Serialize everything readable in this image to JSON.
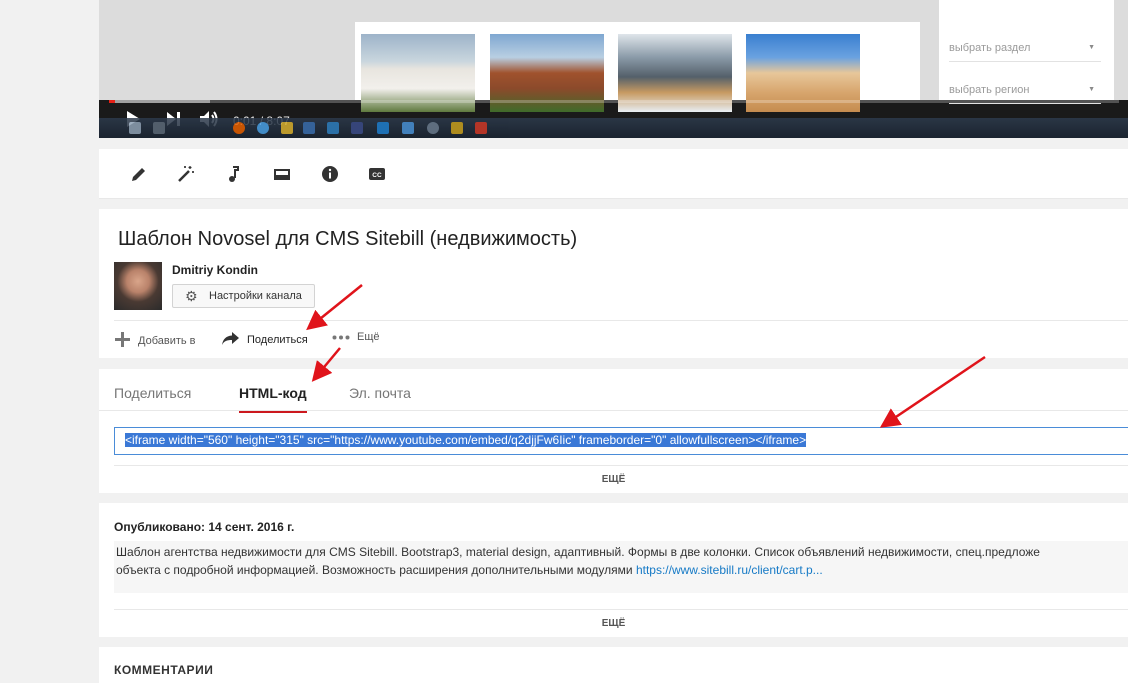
{
  "player": {
    "current_time": "0:01",
    "separator": "/",
    "duration": "8:07",
    "progress": 0.002,
    "filters": [
      {
        "label": "выбрать раздел"
      },
      {
        "label": "выбрать регион"
      }
    ]
  },
  "video": {
    "title": "Шаблон Novosel для CMS Sitebill (недвижимость)",
    "owner": "Dmitriy Kondin",
    "channel_settings": "Настройки канала"
  },
  "actions": {
    "add_to": "Добавить в",
    "share": "Поделиться",
    "more": "Ещё"
  },
  "share": {
    "tabs": [
      {
        "label": "Поделиться"
      },
      {
        "label": "HTML-код"
      },
      {
        "label": "Эл. почта"
      }
    ],
    "embed_code": "<iframe width=\"560\" height=\"315\" src=\"https://www.youtube.com/embed/q2djjFw6Iic\" frameborder=\"0\" allowfullscreen></iframe>",
    "more": "ЕЩЁ"
  },
  "description": {
    "published": "Опубликовано: 14 сент. 2016 г.",
    "line1": "Шаблон агентства недвижимости для CMS Sitebill. Bootstrap3, material design, адаптивный. Формы в две колонки. Список объявлений недвижимости, спец.предложе",
    "line2": "объекта с подробной информацией. Возможность расширения дополнительными модулями",
    "link": "https://www.sitebill.ru/client/cart.p...",
    "more": "ЕЩЁ"
  },
  "comments": {
    "title": "КОММЕНТАРИИ"
  },
  "colors": {
    "accent_red": "#cc181e",
    "link_blue": "#167ac6",
    "selection_blue": "#3a78d6",
    "arrow_red": "#e0141b"
  }
}
